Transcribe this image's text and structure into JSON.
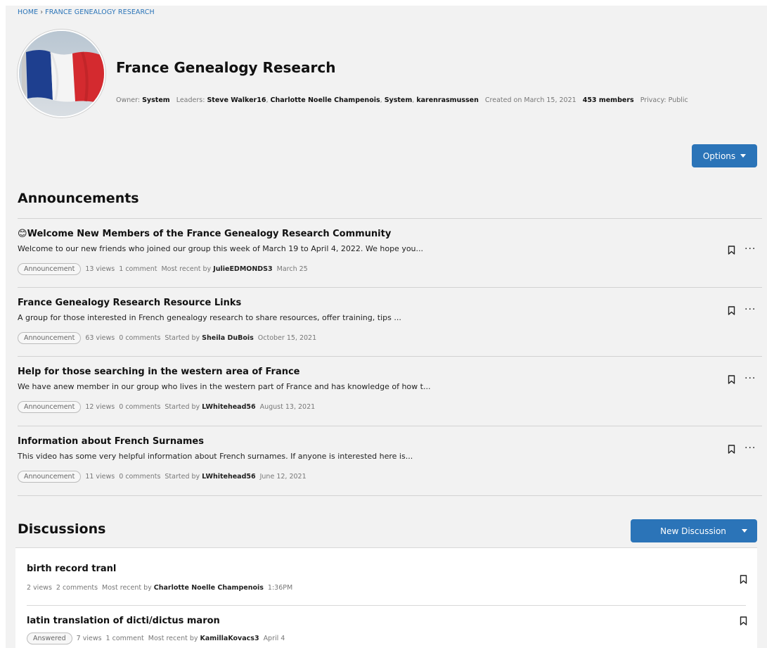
{
  "breadcrumb": {
    "home": "HOME",
    "separator": "›",
    "current": "FRANCE GENEALOGY RESEARCH"
  },
  "group": {
    "title": "France Genealogy Research",
    "owner_label": "Owner:",
    "owner": "System",
    "leaders_label": "Leaders:",
    "leaders": [
      "Steve Walker16",
      "Charlotte Noelle Champenois",
      "System",
      "karenrasmussen"
    ],
    "created": "Created on March 15, 2021",
    "members": "453 members",
    "privacy": "Privacy: Public",
    "avatar_icon": "france-flag-image"
  },
  "options_button": {
    "label": "Options",
    "icon": "caret-down-icon"
  },
  "announcements": {
    "heading": "Announcements",
    "items": [
      {
        "emoji": "😊",
        "title": "Welcome New Members of the France Genealogy Research Community",
        "excerpt": "Welcome to our new friends who joined our group this week of March 19 to April 4, 2022. We hope you...",
        "tag": "Announcement",
        "views": "13 views",
        "comments": "1 comment",
        "by_label": "Most recent by",
        "author": "JulieEDMONDS3",
        "date": "March 25"
      },
      {
        "emoji": "",
        "title": "France Genealogy Research Resource Links",
        "excerpt": "A group for those interested in French genealogy research to share resources, offer training, tips ...",
        "tag": "Announcement",
        "views": "63 views",
        "comments": "0 comments",
        "by_label": "Started by",
        "author": "Sheila DuBois",
        "date": "October 15, 2021"
      },
      {
        "emoji": "",
        "title": "Help for those searching in the western area of France",
        "excerpt": "We have anew member in our group who lives in the western part of France and has knowledge of how t...",
        "tag": "Announcement",
        "views": "12 views",
        "comments": "0 comments",
        "by_label": "Started by",
        "author": "LWhitehead56",
        "date": "August 13, 2021"
      },
      {
        "emoji": "",
        "title": "Information about French Surnames",
        "excerpt": "This video has some very helpful information about French surnames. If anyone is interested here is...",
        "tag": "Announcement",
        "views": "11 views",
        "comments": "0 comments",
        "by_label": "Started by",
        "author": "LWhitehead56",
        "date": "June 12, 2021"
      }
    ]
  },
  "discussions": {
    "heading": "Discussions",
    "new_button": "New Discussion",
    "items": [
      {
        "title": "birth record tranl",
        "tag": "",
        "views": "2 views",
        "comments": "2 comments",
        "by_label": "Most recent by",
        "author": "Charlotte Noelle Champenois",
        "date": "1:36PM"
      },
      {
        "title": "latin translation of dicti/dictus maron",
        "tag": "Answered",
        "views": "7 views",
        "comments": "1 comment",
        "by_label": "Most recent by",
        "author": "KamillaKovacs3",
        "date": "April 4"
      }
    ]
  },
  "icons": {
    "bookmark": "bookmark-icon",
    "more": "more-options-icon"
  },
  "colors": {
    "accent": "#2b74b8",
    "background": "#f2f2f2",
    "flag_blue": "#1e3f8f",
    "flag_red": "#d42a2f"
  }
}
